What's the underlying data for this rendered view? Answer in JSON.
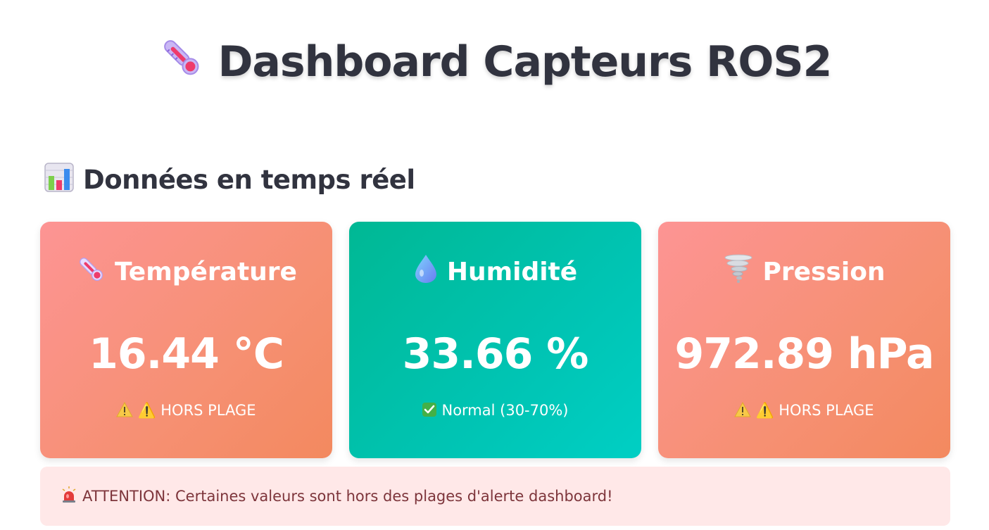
{
  "header": {
    "title": "Dashboard Capteurs ROS2",
    "icon": "thermometer-icon"
  },
  "section": {
    "title": "Données en temps réel",
    "icon": "bar-chart-icon"
  },
  "cards": [
    {
      "title": "Température",
      "icon": "thermometer-icon",
      "value": "16.44 °C",
      "status": "⚠️ HORS PLAGE",
      "status_icon": "warning-icon",
      "color": "#f69073"
    },
    {
      "title": "Humidité",
      "icon": "droplet-icon",
      "value": "33.66 %",
      "status": "Normal (30-70%)",
      "status_icon": "check-icon",
      "color": "#00c4b3"
    },
    {
      "title": "Pression",
      "icon": "tornado-icon",
      "value": "972.89 hPa",
      "status": "⚠️ HORS PLAGE",
      "status_icon": "warning-icon",
      "color": "#f69073"
    }
  ],
  "alert": {
    "icon": "siren-icon",
    "text": "ATTENTION: Certaines valeurs sont hors des plages d'alerte dashboard!",
    "background": "#ffe8e8",
    "text_color": "#7d353b"
  }
}
